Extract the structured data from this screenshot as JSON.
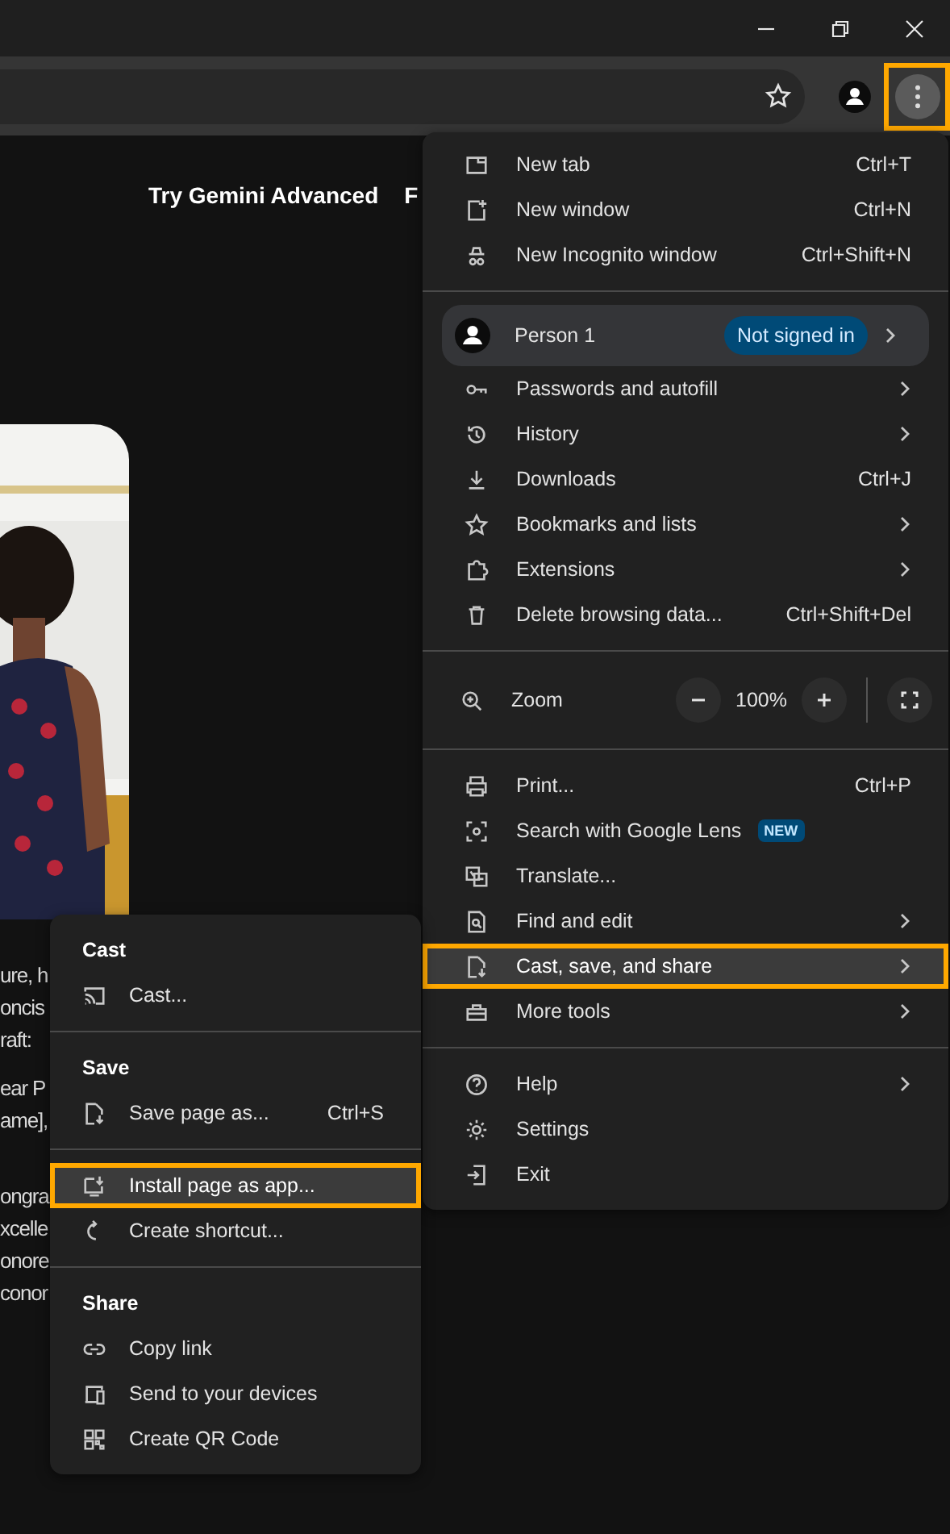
{
  "toolbar": {
    "menu_button": {
      "highlighted": true
    }
  },
  "page": {
    "nav_links": [
      "Try Gemini Advanced",
      "F"
    ],
    "picture": {
      "kind": "picture"
    },
    "text_lines": [
      [
        "ure, h",
        "oncis",
        "raft:"
      ],
      [
        "ear P",
        "ame],"
      ],
      [
        "ongra",
        "xcelle",
        "onore",
        "conor"
      ]
    ]
  },
  "menu": {
    "sections": [
      {
        "items": [
          {
            "kind": "item",
            "label": "New tab",
            "shortcut": "Ctrl+T",
            "submenu": false,
            "highlighted": false
          },
          {
            "kind": "item",
            "label": "New window",
            "shortcut": "Ctrl+N",
            "submenu": false,
            "highlighted": false
          },
          {
            "kind": "item",
            "label": "New Incognito window",
            "shortcut": "Ctrl+Shift+N",
            "submenu": false,
            "highlighted": false
          }
        ]
      },
      {
        "items": [
          {
            "kind": "profile",
            "label": "Person 1",
            "badge": "Not signed in",
            "submenu": true
          },
          {
            "kind": "item",
            "label": "Passwords and autofill",
            "submenu": true,
            "highlighted": false
          },
          {
            "kind": "item",
            "label": "History",
            "submenu": true,
            "highlighted": false
          },
          {
            "kind": "item",
            "label": "Downloads",
            "shortcut": "Ctrl+J",
            "submenu": false,
            "highlighted": false
          },
          {
            "kind": "item",
            "label": "Bookmarks and lists",
            "submenu": true,
            "highlighted": false
          },
          {
            "kind": "item",
            "label": "Extensions",
            "submenu": true,
            "highlighted": false
          },
          {
            "kind": "item",
            "label": "Delete browsing data...",
            "shortcut": "Ctrl+Shift+Del",
            "submenu": false,
            "highlighted": false
          }
        ]
      },
      {
        "items": [
          {
            "kind": "zoom",
            "label": "Zoom",
            "value": "100%"
          }
        ]
      },
      {
        "items": [
          {
            "kind": "item",
            "label": "Print...",
            "shortcut": "Ctrl+P",
            "submenu": false,
            "highlighted": false
          },
          {
            "kind": "item",
            "label": "Search with Google Lens",
            "badge": "NEW",
            "submenu": false,
            "highlighted": false
          },
          {
            "kind": "item",
            "label": "Translate...",
            "submenu": false,
            "highlighted": false
          },
          {
            "kind": "item",
            "label": "Find and edit",
            "submenu": true,
            "highlighted": false
          },
          {
            "kind": "item",
            "label": "Cast, save, and share",
            "submenu": true,
            "highlighted": true
          },
          {
            "kind": "item",
            "label": "More tools",
            "submenu": true,
            "highlighted": false
          }
        ]
      },
      {
        "items": [
          {
            "kind": "item",
            "label": "Help",
            "submenu": true,
            "highlighted": false
          },
          {
            "kind": "item",
            "label": "Settings",
            "submenu": false,
            "highlighted": false
          },
          {
            "kind": "item",
            "label": "Exit",
            "submenu": false,
            "highlighted": false
          }
        ]
      }
    ]
  },
  "submenu": {
    "sections": [
      {
        "header": "Cast",
        "items": [
          {
            "label": "Cast...",
            "highlighted": false
          }
        ]
      },
      {
        "header": "Save",
        "items": [
          {
            "label": "Save page as...",
            "shortcut": "Ctrl+S",
            "highlighted": false
          }
        ]
      },
      {
        "items": [
          {
            "label": "Install page as app...",
            "highlighted": true
          },
          {
            "label": "Create shortcut...",
            "highlighted": false
          }
        ]
      },
      {
        "header": "Share",
        "items": [
          {
            "label": "Copy link",
            "highlighted": false
          },
          {
            "label": "Send to your devices",
            "highlighted": false
          },
          {
            "label": "Create QR Code",
            "highlighted": false
          }
        ]
      }
    ]
  }
}
